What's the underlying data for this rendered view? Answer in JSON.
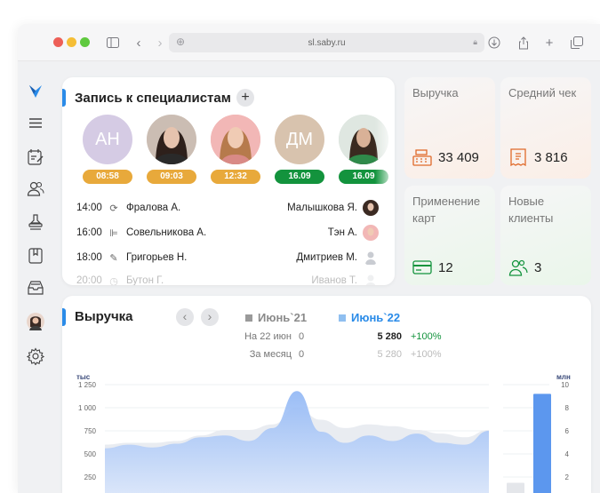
{
  "browser": {
    "url": "sl.saby.ru"
  },
  "sidebar": {
    "items": [
      {
        "icon": "logo-icon"
      },
      {
        "icon": "menu-icon"
      },
      {
        "icon": "calendar-icon"
      },
      {
        "icon": "users-icon"
      },
      {
        "icon": "stamp-icon"
      },
      {
        "icon": "book-icon"
      },
      {
        "icon": "inbox-icon"
      },
      {
        "icon": "profile-avatar"
      },
      {
        "icon": "gear-icon"
      }
    ]
  },
  "appointments": {
    "title": "Запись к специалистам",
    "specialists": [
      {
        "initials": "АН",
        "time": "08:58",
        "bg": "#d5cbe4",
        "badge": "#e8a93b"
      },
      {
        "initials": "",
        "time": "09:03",
        "bg": "#3b2a22",
        "badge": "#e8a93b"
      },
      {
        "initials": "",
        "time": "12:32",
        "bg": "#f2b7b6",
        "badge": "#e8a93b"
      },
      {
        "initials": "ДМ",
        "time": "16.09",
        "bg": "#d8c3ae",
        "badge": "#13933d"
      },
      {
        "initials": "",
        "time": "16.09",
        "bg": "#cbd9d2",
        "badge": "#13933d"
      }
    ],
    "rows": [
      {
        "time": "14:00",
        "client": "Фралова А.",
        "specialist": "Малышкова Я."
      },
      {
        "time": "16:00",
        "client": "Совельникова А.",
        "specialist": "Тэн А."
      },
      {
        "time": "18:00",
        "client": "Григорьев Н.",
        "specialist": "Дмитриев М."
      },
      {
        "time": "20:00",
        "client": "Бутон Г.",
        "specialist": "Иванов Т."
      }
    ]
  },
  "kpis": [
    {
      "label": "Выручка",
      "value": "33 409",
      "icon": "cash-register-icon"
    },
    {
      "label": "Средний чек",
      "value": "3 816",
      "icon": "receipt-icon"
    },
    {
      "label": "Применение карт",
      "value": "12",
      "icon": "card-icon"
    },
    {
      "label": "Новые клиенты",
      "value": "3",
      "icon": "new-clients-icon"
    }
  ],
  "revenue": {
    "title": "Выручка",
    "series_prev": "Июнь`21",
    "series_cur": "Июнь`22",
    "rows": [
      {
        "label": "На 22 июн",
        "prev": "0",
        "cur": "5 280",
        "delta": "+100%"
      },
      {
        "label": "За месяц",
        "prev": "0",
        "cur": "5 280",
        "delta": "+100%"
      }
    ],
    "colors": {
      "prev": "#9a9a9a",
      "cur": "#2a8be8",
      "delta": "#13933d"
    }
  },
  "chart_data": {
    "type": "area",
    "ylabel_left": "тыс",
    "ylabel_right": "млн",
    "left_ticks": [
      "1 250",
      "1 000",
      "750",
      "500",
      "250"
    ],
    "right_ticks": [
      "10",
      "8",
      "6",
      "4",
      "2"
    ],
    "series": [
      {
        "values": [
          560,
          600,
          570,
          610,
          680,
          700,
          640,
          780,
          1180,
          740,
          620,
          700,
          640,
          720,
          620,
          600,
          750
        ]
      },
      {
        "values": [
          600,
          620,
          620,
          640,
          700,
          760,
          760,
          820,
          1000,
          870,
          780,
          820,
          800,
          760,
          720,
          680,
          760
        ]
      }
    ],
    "ylim": [
      0,
      1250
    ],
    "bars_right": {
      "values": [
        1.5,
        9.2
      ],
      "ylim": [
        0,
        10
      ]
    }
  }
}
